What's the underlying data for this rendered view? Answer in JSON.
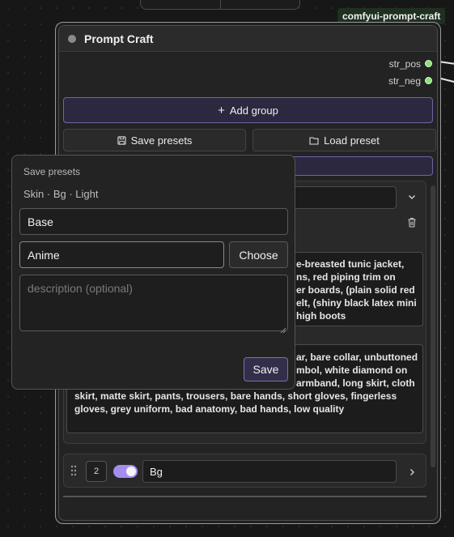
{
  "badge": "comfyui-prompt-craft",
  "node": {
    "title": "Prompt Craft",
    "outputs": [
      "str_pos",
      "str_neg"
    ],
    "add_group_label": "Add group",
    "save_presets_label": "Save presets",
    "load_preset_label": "Load preset",
    "positive_text_visible": "e-breasted tunic jacket, ns, red piping trim on er boards, (plain solid red elt, (shiny black latex mini high boots",
    "positive_lines": [
      "e-breasted tunic jacket,",
      "ns, red piping trim on",
      "er boards, (plain solid red",
      "elt, (shiny black latex mini",
      "high boots"
    ],
    "negative_lines": [
      "ar, bare collar, unbuttoned",
      "mbol, white diamond on",
      "armband, long skirt, cloth",
      "skirt, matte skirt, pants, trousers, bare hands, short gloves, fingerless",
      "gloves, grey uniform, bad anatomy, bad hands, low quality"
    ],
    "group2": {
      "index": "2",
      "name": "Bg"
    }
  },
  "popover": {
    "title": "Save presets",
    "subtitle": "Skin · Bg · Light",
    "name_value": "Base",
    "folder_value": "Anime",
    "choose_label": "Choose",
    "description_placeholder": "description (optional)",
    "save_label": "Save"
  }
}
